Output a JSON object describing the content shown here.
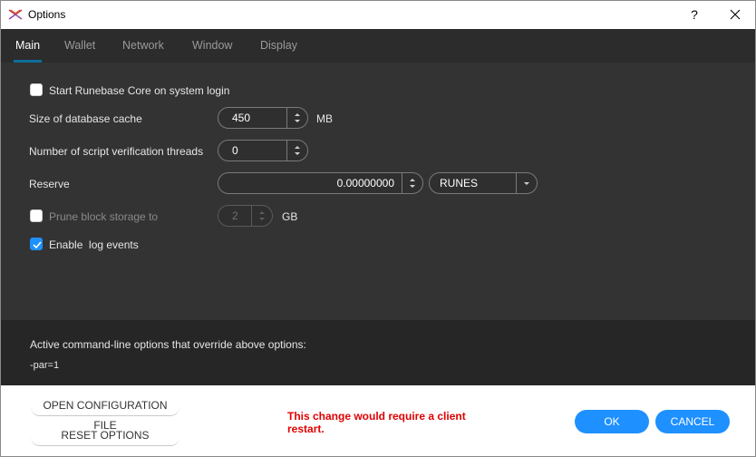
{
  "window": {
    "title": "Options",
    "help": "?",
    "close": "✕"
  },
  "tabs": [
    "Main",
    "Wallet",
    "Network",
    "Window",
    "Display"
  ],
  "main": {
    "start_on_login": {
      "label": "Start Runebase Core on system login",
      "checked": false
    },
    "db_cache": {
      "label": "Size of database cache",
      "value": "450",
      "unit": "MB"
    },
    "script_threads": {
      "label": "Number of script verification threads",
      "value": "0"
    },
    "reserve": {
      "label": "Reserve",
      "value": "0.00000000",
      "unit_select": "RUNES"
    },
    "prune": {
      "label": "Prune block storage to",
      "value": "2",
      "unit": "GB",
      "checked": false
    },
    "log_events": {
      "label": "Enable  log events",
      "checked": true
    }
  },
  "cmd": {
    "title": "Active command-line options that override above options:",
    "value": "-par=1"
  },
  "footer": {
    "open_config": "OPEN CONFIGURATION FILE",
    "reset": "RESET OPTIONS",
    "warning": "This change would require a client restart.",
    "ok": "OK",
    "cancel": "CANCEL"
  },
  "colors": {
    "accent": "#1e90ff",
    "warning": "#e00000",
    "panel": "#333333",
    "tab_underline": "#0f6e9c"
  }
}
